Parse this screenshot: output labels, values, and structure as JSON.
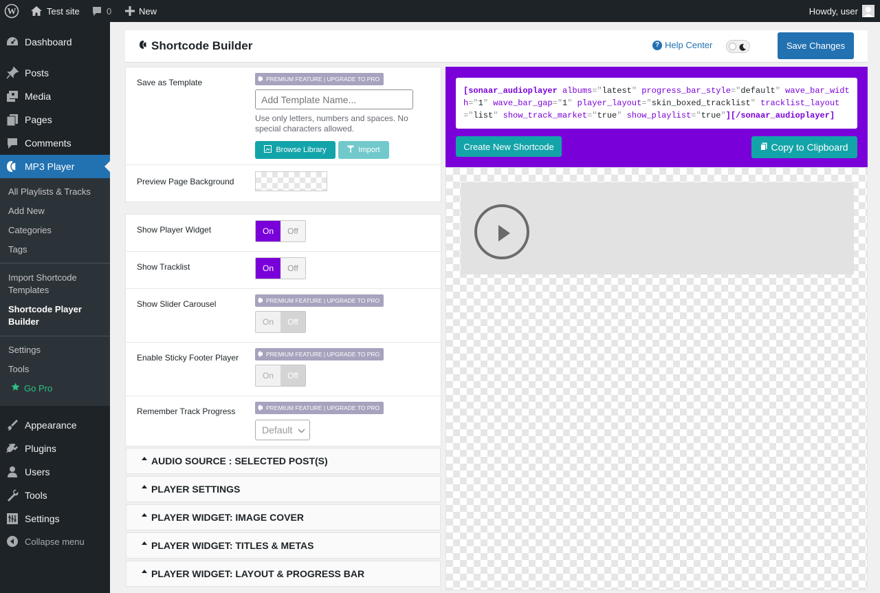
{
  "adminbar": {
    "site_name": "Test site",
    "comments_count": "0",
    "new_label": "New",
    "greeting": "Howdy, user"
  },
  "menu": {
    "dashboard": "Dashboard",
    "posts": "Posts",
    "media": "Media",
    "pages": "Pages",
    "comments": "Comments",
    "mp3player": "MP3 Player",
    "sub": {
      "all": "All Playlists & Tracks",
      "add_new": "Add New",
      "categories": "Categories",
      "tags": "Tags",
      "import": "Import Shortcode Templates",
      "builder": "Shortcode Player Builder",
      "settings": "Settings",
      "tools": "Tools",
      "gopro": "Go Pro"
    },
    "appearance": "Appearance",
    "plugins": "Plugins",
    "users": "Users",
    "tools": "Tools",
    "settings": "Settings",
    "collapse": "Collapse menu"
  },
  "header": {
    "title": "Shortcode Builder",
    "help": "Help Center",
    "save": "Save Changes"
  },
  "form": {
    "premium_badge": "PREMIUM FEATURE | UPGRADE TO PRO",
    "template_label": "Save as Template",
    "template_placeholder": "Add Template Name...",
    "template_help": "Use only letters, numbers and spaces. No special characters allowed.",
    "browse": "Browse Library",
    "import": "Import",
    "bg_label": "Preview Page Background",
    "on": "On",
    "off": "Off",
    "widget_label": "Show Player Widget",
    "tracklist_label": "Show Tracklist",
    "slider_label": "Show Slider Carousel",
    "sticky_label": "Enable Sticky Footer Player",
    "remember_label": "Remember Track Progress",
    "remember_value": "Default"
  },
  "sections": [
    "AUDIO SOURCE : SELECTED POST(S)",
    "PLAYER SETTINGS",
    "PLAYER WIDGET: IMAGE COVER",
    "PLAYER WIDGET: TITLES & METAS",
    "PLAYER WIDGET: LAYOUT & PROGRESS BAR"
  ],
  "shortcode": {
    "open": "[sonaar_audioplayer",
    "close": "][/sonaar_audioplayer]",
    "attrs": [
      {
        "name": "albums",
        "value": "latest"
      },
      {
        "name": "progress_bar_style",
        "value": "default"
      },
      {
        "name": "wave_bar_width",
        "value": "1"
      },
      {
        "name": "wave_bar_gap",
        "value": "1"
      },
      {
        "name": "player_layout",
        "value": "skin_boxed_tracklist"
      },
      {
        "name": "tracklist_layout",
        "value": "list"
      },
      {
        "name": "show_track_market",
        "value": "true"
      },
      {
        "name": "show_playlist",
        "value": "true"
      }
    ],
    "create": "Create New Shortcode",
    "copy": "Copy to Clipboard"
  },
  "colors": {
    "accent": "#7a00d9",
    "wp_blue": "#2271b1",
    "teal": "#13a4a9",
    "admin_dark": "#1d2327"
  }
}
